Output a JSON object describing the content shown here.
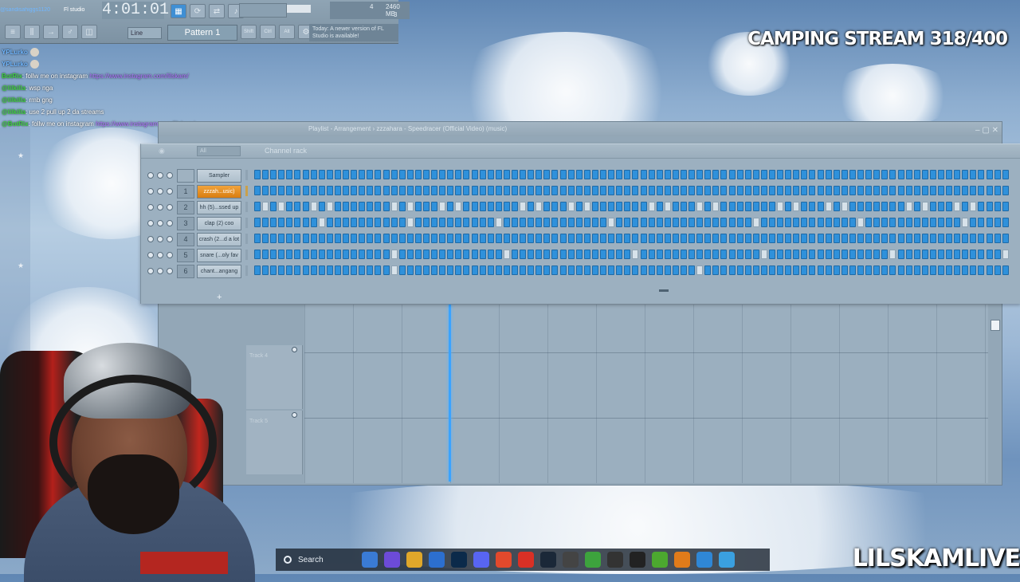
{
  "fl_top": {
    "timer": "4:01:01",
    "chat_top_user": "@sandisahiggs1120",
    "chat_top_msg": "Fl studio",
    "memory": "2460 MB",
    "mem_val1": "4",
    "mem_val2": "3",
    "line_mode": "Line",
    "pattern": "Pattern 1",
    "update_hint": "Today: A newer version of FL Studio is available!",
    "buttons": [
      "Shift",
      "Ctrl",
      "Alt"
    ]
  },
  "stream": {
    "title": "CAMPING STREAM 318/400",
    "channel": "LILSKAMLIVE"
  },
  "chat": [
    {
      "user": "YPLurko",
      "emote": true,
      "text": ""
    },
    {
      "user": "YPLurko",
      "emote": true,
      "text": ""
    },
    {
      "user": "BotRix",
      "text": ": follw me on instagram ",
      "link": "https://www.instagram.com/lilskam/"
    },
    {
      "user": "@lilkilla",
      "text": ": wsp nga"
    },
    {
      "user": "@lilkilla",
      "text": ": rmb gng"
    },
    {
      "user": "@lilkilla",
      "text": ": use 2 pull up 2 da streams"
    },
    {
      "user": "@BotRix",
      "text": ": follw me on instagram ",
      "link": "https://www.instagram.com/lilskam/"
    }
  ],
  "playlist": {
    "title": "Playlist - Arrangement › zzzahara - Speedracer (Official Video) (music)",
    "tracks": [
      "Track 4",
      "Track 5"
    ]
  },
  "channel_rack": {
    "title": "Channel rack",
    "filter": "All",
    "channels": [
      {
        "num": "",
        "name": "Sampler",
        "active": false,
        "pattern": "1111111111111111111111111111111111111111111111111111111111111111111111111111111111111111111111"
      },
      {
        "num": "1",
        "name": "zzzah...usic)",
        "active": true,
        "pattern": "1111111111111111111111111111111111111111111111111111111111111111111111111111111111111111111111"
      },
      {
        "num": "2",
        "name": "hh (5)...ssed up",
        "active": false,
        "pattern": "1010111010111111101011101011111110101110101111111010111010111111101011101011111110101110101111"
      },
      {
        "num": "3",
        "name": "clap (2) coo",
        "active": false,
        "pattern": "1111111101111111111011111111110111111111111101111111111111111101111111111110111111111111011111"
      },
      {
        "num": "4",
        "name": "crash (2...d a lot",
        "active": false,
        "pattern": "1111111111111111111111111111111111111111111111111111111111111111111111111111111111111111111111"
      },
      {
        "num": "5",
        "name": "snare (...oly fav",
        "active": false,
        "pattern": "1111111111111111101111111111111011111111111111101111111111111110111111111111111011111111111110"
      },
      {
        "num": "6",
        "name": "chant...angang",
        "active": false,
        "pattern": "1111111111111111101111111111111111111111111111111111111011111111111111111111111111111111111111"
      }
    ]
  },
  "taskbar": {
    "search": "Search",
    "apps": [
      {
        "icon": "widgets-icon",
        "color": "#3a7bd5"
      },
      {
        "icon": "copilot-icon",
        "color": "#6c4bd8"
      },
      {
        "icon": "folder-icon",
        "color": "#e0a72a"
      },
      {
        "icon": "store-icon",
        "color": "#2c6fcf"
      },
      {
        "icon": "photoshop-icon",
        "color": "#0b2a4a"
      },
      {
        "icon": "discord-icon",
        "color": "#5865f2"
      },
      {
        "icon": "brave-icon",
        "color": "#e2492c"
      },
      {
        "icon": "chrome-icon",
        "color": "#d93025"
      },
      {
        "icon": "steam-icon",
        "color": "#1b2838"
      },
      {
        "icon": "app-icon",
        "color": "#444"
      },
      {
        "icon": "bluestacks-icon",
        "color": "#3da33d"
      },
      {
        "icon": "4k-icon",
        "color": "#333"
      },
      {
        "icon": "capcut-icon",
        "color": "#222"
      },
      {
        "icon": "utorrent-icon",
        "color": "#4ca82f"
      },
      {
        "icon": "fl-studio-icon",
        "color": "#e07b1a"
      },
      {
        "icon": "paint-icon",
        "color": "#2f87d6"
      },
      {
        "icon": "notepad-icon",
        "color": "#3aa0e0"
      }
    ]
  }
}
